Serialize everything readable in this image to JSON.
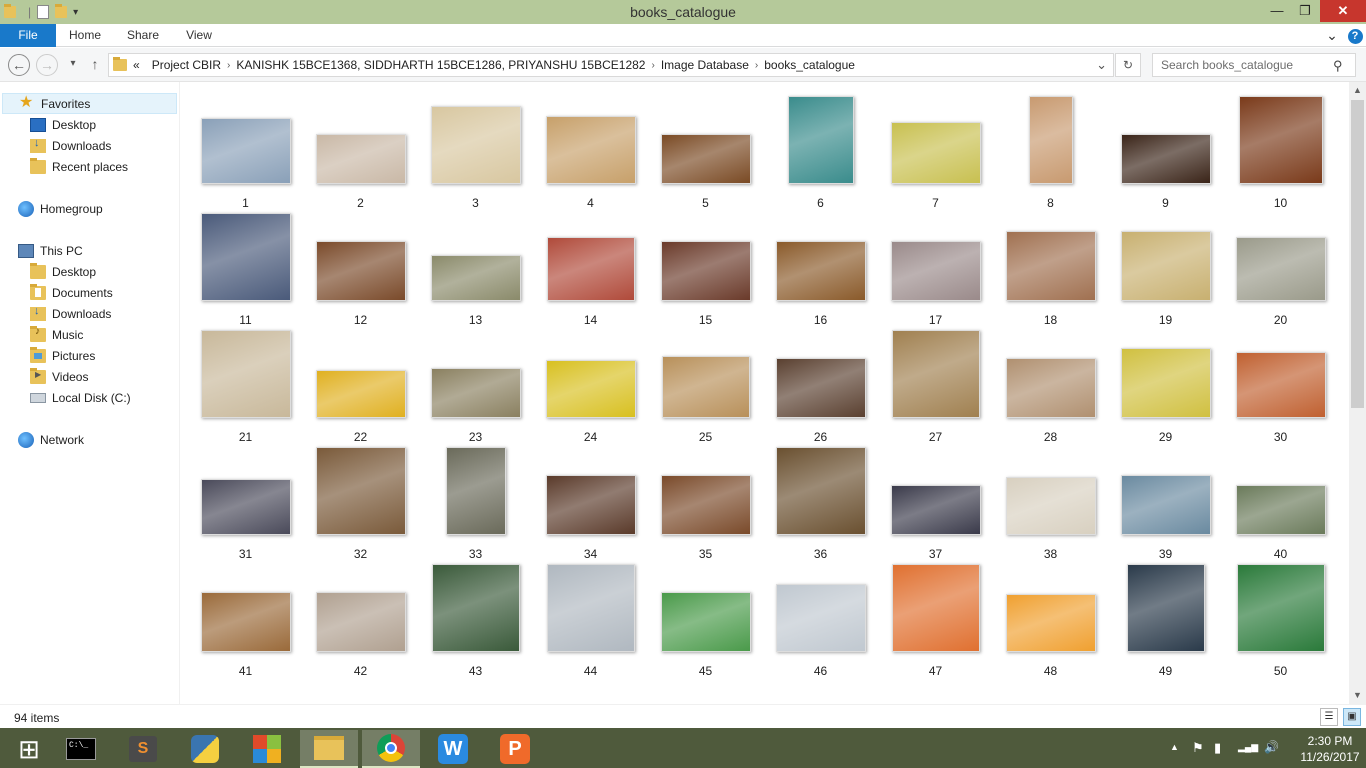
{
  "window": {
    "title": "books_catalogue",
    "minimize_glyph": "—",
    "maximize_glyph": "❐",
    "close_glyph": "✕"
  },
  "ribbon": {
    "tabs": [
      "File",
      "Home",
      "Share",
      "View"
    ],
    "expand_glyph": "⌄",
    "help_glyph": "?"
  },
  "nav": {
    "back_glyph": "←",
    "forward_glyph": "→",
    "recent_glyph": "▾",
    "up_glyph": "↑",
    "overflow_glyph": "«",
    "breadcrumb": [
      "Project CBIR",
      "KANISHK 15BCE1368, SIDDHARTH 15BCE1286, PRIYANSHU 15BCE1282",
      "Image Database",
      "books_catalogue"
    ],
    "dropdown_glyph": "⌄",
    "refresh_glyph": "↻",
    "search_placeholder": "Search books_catalogue",
    "search_icon_glyph": "⚲"
  },
  "sidebar": {
    "favorites": "Favorites",
    "favorites_items": [
      "Desktop",
      "Downloads",
      "Recent places"
    ],
    "homegroup": "Homegroup",
    "thispc": "This PC",
    "thispc_items": [
      "Desktop",
      "Documents",
      "Downloads",
      "Music",
      "Pictures",
      "Videos",
      "Local Disk (C:)"
    ],
    "network": "Network"
  },
  "files": {
    "labels": [
      "1",
      "2",
      "3",
      "4",
      "5",
      "6",
      "7",
      "8",
      "9",
      "10",
      "11",
      "12",
      "13",
      "14",
      "15",
      "16",
      "17",
      "18",
      "19",
      "20",
      "21",
      "22",
      "23",
      "24",
      "25",
      "26",
      "27",
      "28",
      "29",
      "30",
      "31",
      "32",
      "33",
      "34",
      "35",
      "36",
      "37",
      "38",
      "39",
      "40",
      "41",
      "42",
      "43",
      "44",
      "45",
      "46",
      "47",
      "48",
      "49",
      "50",
      "",
      "",
      "",
      "",
      "",
      "",
      "",
      "",
      "",
      ""
    ],
    "thumbnail_colors": [
      "#8aa0b8",
      "#c9b8a6",
      "#d8c7a0",
      "#c7a06a",
      "#7a4a24",
      "#3a8c8c",
      "#c8c050",
      "#c89a70",
      "#3a2418",
      "#7a3a1a",
      "#4a5a7a",
      "#7a4a2a",
      "#8a8a6a",
      "#b04a3a",
      "#6a3a2a",
      "#8a5a2a",
      "#9a8a8a",
      "#a07050",
      "#c8b070",
      "#9a9a8a",
      "#c8b89a",
      "#e0b020",
      "#8a8060",
      "#d8c020",
      "#b8905a",
      "#5a4030",
      "#a08050",
      "#b09070",
      "#d0c040",
      "#c06030",
      "#4a4a5a",
      "#7a5a3a",
      "#6a6a5a",
      "#5a3a2a",
      "#7a4a2a",
      "#6a5030",
      "#3a3a4a",
      "#d8d0c0",
      "#6a8aa0",
      "#6a7a5a",
      "#9a6a3a",
      "#b0a090",
      "#3a5a3a",
      "#b0b8c0",
      "#4a9a4a",
      "#c0c8d0",
      "#e07030",
      "#f0a030",
      "#2a3a4a",
      "#2a7a3a",
      "#4a8ad0",
      "#1a3a8a",
      "#2a5aa0",
      "#5a8a4a",
      "#d0d0d0",
      "#a0c0e0",
      "#2a2a2a",
      "#e04040",
      "#d0d0d0",
      "#cccccc"
    ]
  },
  "status": {
    "item_count": "94 items",
    "details_view_glyph": "☰",
    "large_icons_glyph": "▣"
  },
  "taskbar": {
    "start_glyph": "⊞",
    "cmd_label": "C:\\_",
    "sublime_label": "S",
    "wps_writer_label": "W",
    "wps_presentation_label": "P",
    "time": "2:30 PM",
    "date": "11/26/2017",
    "tray_up": "▲",
    "tray_flag": "⚑",
    "tray_signal": "▂▄▆",
    "tray_volume": "🔊"
  }
}
